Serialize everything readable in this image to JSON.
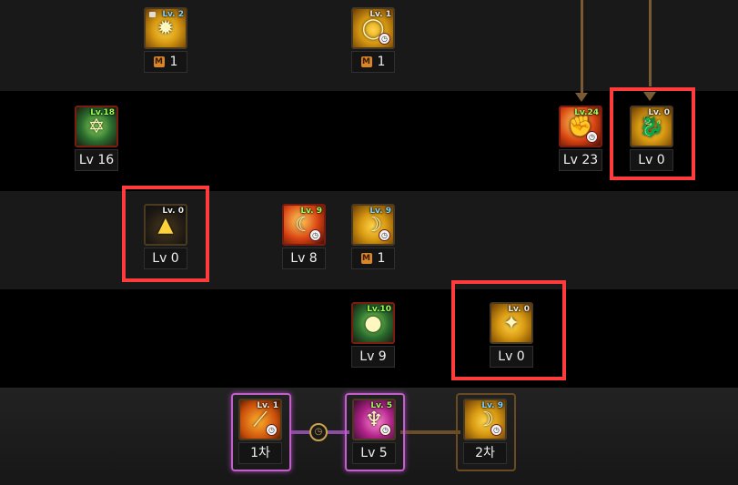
{
  "colors": {
    "band_dark": "#191919",
    "band_black": "#000000",
    "highlight_box": "#ff3b3b",
    "connector": "#7a5a32",
    "level_green": "#9dff5a",
    "level_blue": "#7fd4ff",
    "awakening_purple": "#c060c8"
  },
  "rows": {
    "row1": [
      {
        "name": "skill-r1-a",
        "icon": "gold-burst-icon",
        "lvtag": "Lv. 2",
        "lvtag_color": "blue",
        "label": "1",
        "badge": "M",
        "locked": true,
        "cooldown": false
      },
      {
        "name": "skill-r1-b",
        "icon": "gold-ring-icon",
        "lvtag": "Lv. 1",
        "lvtag_color": "white",
        "label": "1",
        "badge": "M",
        "locked": false,
        "cooldown": true
      }
    ],
    "row2": [
      {
        "name": "skill-r2-a",
        "icon": "hexagram-icon",
        "lvtag": "Lv.18",
        "lvtag_color": "green",
        "label": "Lv 16"
      },
      {
        "name": "skill-r2-b",
        "icon": "fire-fist-icon",
        "lvtag": "Lv.24",
        "lvtag_color": "green",
        "label": "Lv 23"
      },
      {
        "name": "skill-r2-c",
        "icon": "dragon-head-icon",
        "lvtag": "Lv. 0",
        "lvtag_color": "white",
        "label": "Lv 0"
      }
    ],
    "row3": [
      {
        "name": "skill-r3-a",
        "icon": "gold-pile-icon",
        "lvtag": "Lv. 0",
        "lvtag_color": "white",
        "label": "Lv 0"
      },
      {
        "name": "skill-r3-b",
        "icon": "flame-demon-icon",
        "lvtag": "Lv. 9",
        "lvtag_color": "green",
        "label": "Lv 8"
      },
      {
        "name": "skill-r3-c",
        "icon": "gold-crescent-icon",
        "lvtag": "Lv. 9",
        "lvtag_color": "blue",
        "label": "1",
        "badge": "M"
      }
    ],
    "row4": [
      {
        "name": "skill-r4-a",
        "icon": "green-orb-icon",
        "lvtag": "Lv.10",
        "lvtag_color": "green",
        "label": "Lv 9"
      },
      {
        "name": "skill-r4-b",
        "icon": "gold-shards-icon",
        "lvtag": "Lv. 0",
        "lvtag_color": "white",
        "label": "Lv 0"
      }
    ],
    "awakening": [
      {
        "name": "awakening-1st",
        "icon": "orange-slash-icon",
        "lvtag": "Lv. 1",
        "label": "1차"
      },
      {
        "name": "awakening-core",
        "icon": "magenta-figure-icon",
        "lvtag": "Lv. 5",
        "label": "Lv 5"
      },
      {
        "name": "awakening-2nd",
        "icon": "gold-crescent-icon",
        "lvtag": "Lv. 9",
        "label": "2차"
      }
    ]
  }
}
